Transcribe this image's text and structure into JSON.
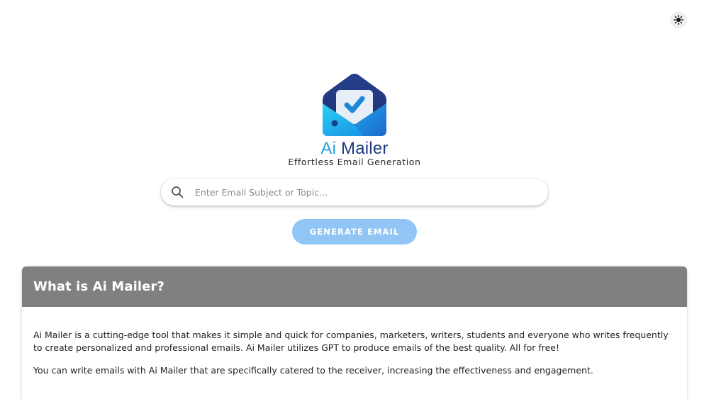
{
  "theme_toggle": {
    "icon": "sun-icon"
  },
  "brand": {
    "logo_icon": "envelope-check-icon",
    "name_part1": "Ai",
    "name_part2": "Mailer",
    "tagline": "Effortless Email Generation",
    "colors": {
      "ai": "#1ea0e3",
      "mailer": "#1c3b80"
    }
  },
  "search": {
    "icon": "search-icon",
    "placeholder": "Enter Email Subject or Topic...",
    "value": ""
  },
  "generate_button": {
    "label": "GENERATE EMAIL",
    "color": "#90c5f5"
  },
  "info_card": {
    "title": "What is Ai Mailer?",
    "header_color": "#808080",
    "paragraphs": [
      "Ai Mailer is a cutting-edge tool that makes it simple and quick for companies, marketers, writers, students and everyone who writes frequently to create personalized and professional emails. Ai Mailer utilizes GPT to produce emails of the best quality. All for free!",
      "You can write emails with Ai Mailer that are specifically catered to the receiver, increasing the effectiveness and engagement."
    ]
  }
}
